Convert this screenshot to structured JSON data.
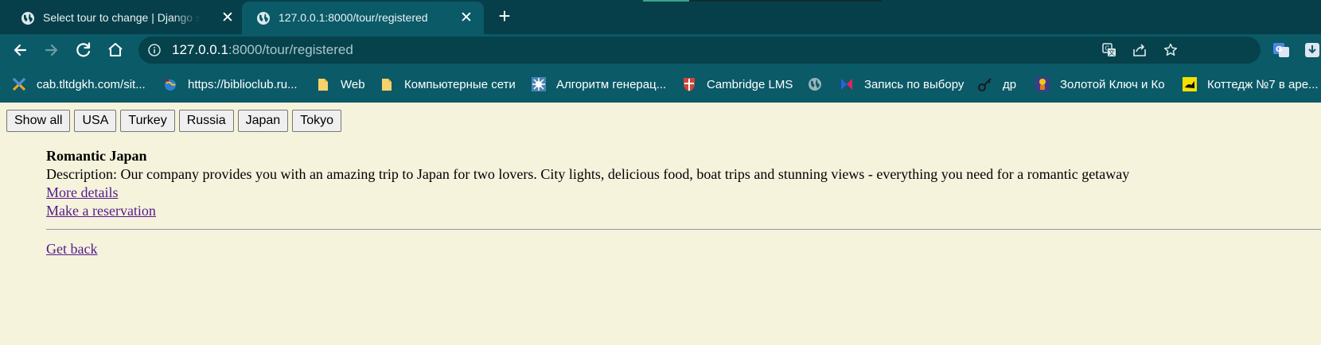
{
  "browser": {
    "tabs": [
      {
        "title": "Select tour to change | Django site admin",
        "active": false
      },
      {
        "title": "127.0.0.1:8000/tour/registered",
        "active": true
      }
    ],
    "address": {
      "host": "127.0.0.1",
      "rest": ":8000/tour/registered"
    },
    "bookmarks": [
      {
        "label": "cab.tltdgkh.com/sit...",
        "icon": "puzzle-icon"
      },
      {
        "label": "https://biblioclub.ru...",
        "icon": "globe-colored-icon"
      },
      {
        "label": "Web",
        "icon": "folder-icon"
      },
      {
        "label": "Компьютерные сети",
        "icon": "folder-icon"
      },
      {
        "label": "Алгоритм генерац...",
        "icon": "gear-icon"
      },
      {
        "label": "Cambridge LMS",
        "icon": "shield-icon"
      },
      {
        "label": "",
        "icon": "globe-icon"
      },
      {
        "label": "Запись по выбору",
        "icon": "butterfly-icon"
      },
      {
        "label": "др",
        "icon": "key-icon"
      },
      {
        "label": "Золотой Ключ и Ко",
        "icon": "character-icon"
      },
      {
        "label": "Коттедж №7 в аре...",
        "icon": "duck-icon"
      }
    ]
  },
  "page": {
    "filters": [
      "Show all",
      "USA",
      "Turkey",
      "Russia",
      "Japan",
      "Tokyo"
    ],
    "tour": {
      "name": "Romantic Japan",
      "description": "Description: Our company provides you with an amazing trip to Japan for two lovers. City lights, delicious food, boat trips and stunning views - everything you need for a romantic getaway",
      "details_link": "More details",
      "reserve_link": "Make a reservation"
    },
    "back_link": "Get back"
  },
  "colors": {
    "tab_strip": "#063f49",
    "toolbar": "#0b5a68",
    "page_background": "#f5f3dc",
    "link": "#551a8b"
  }
}
